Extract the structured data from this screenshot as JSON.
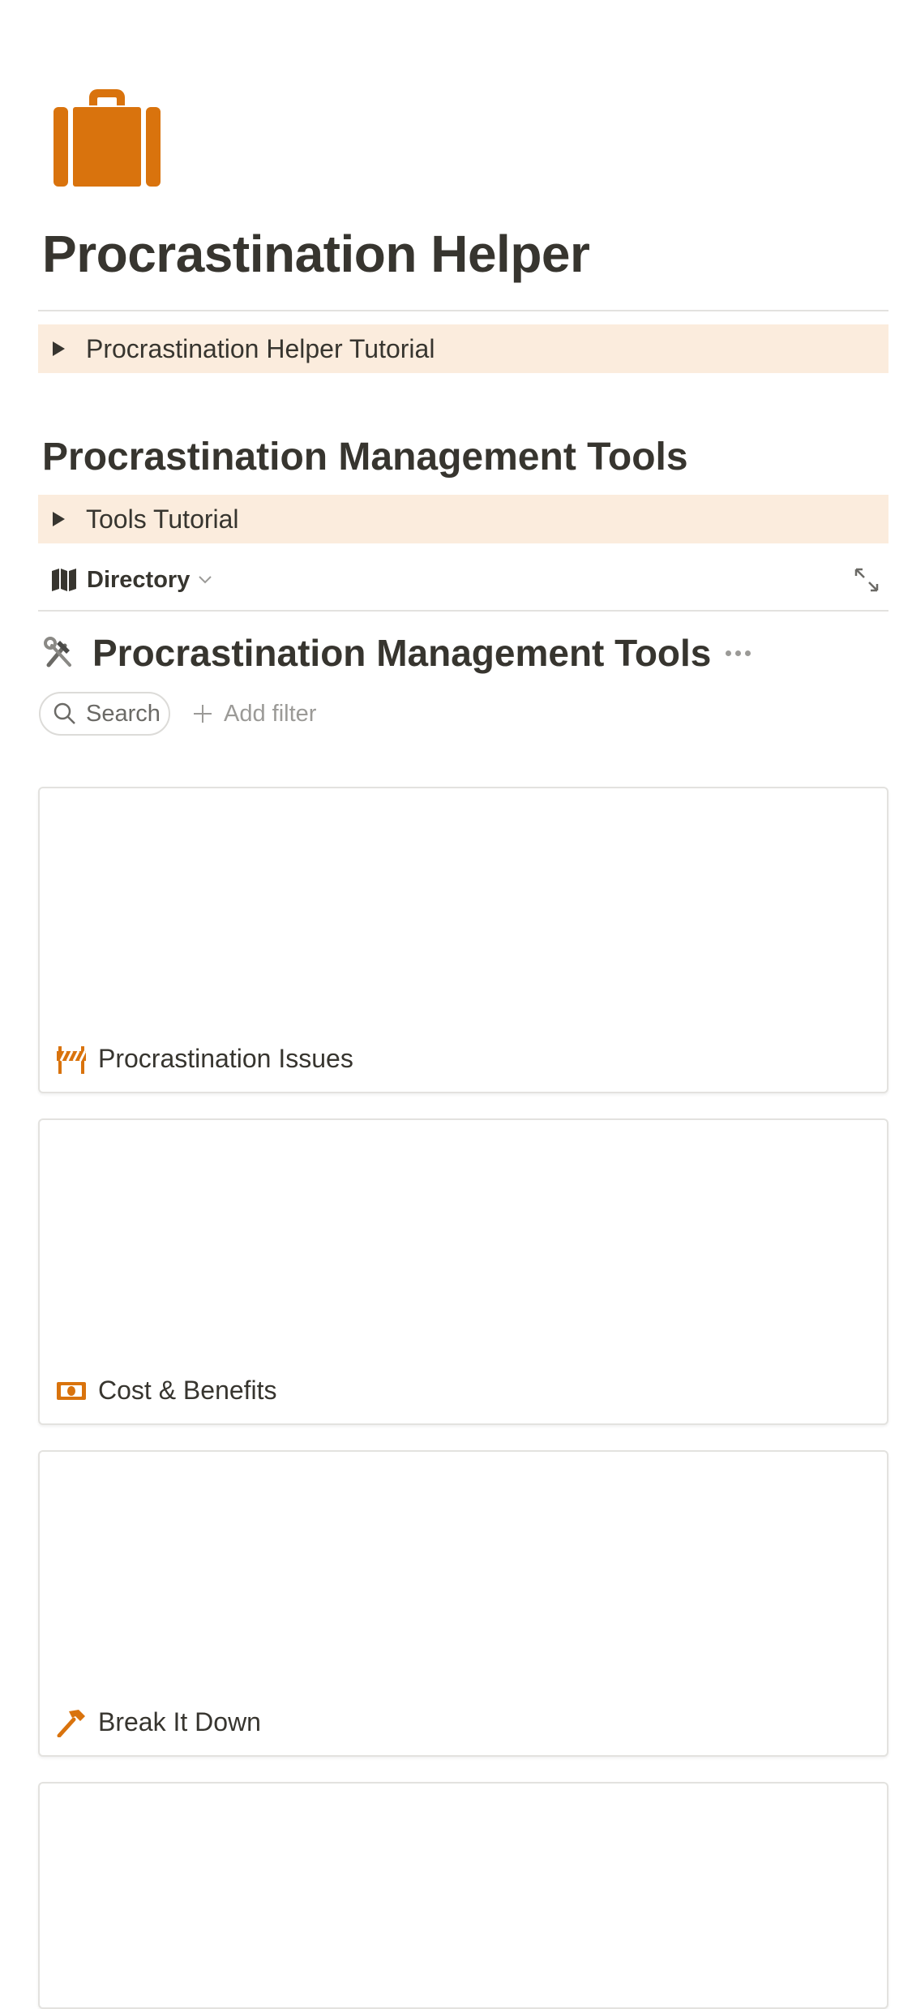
{
  "page": {
    "icon": "briefcase-icon",
    "icon_color": "#d9730d",
    "title": "Procrastination Helper"
  },
  "tutorial_toggle": {
    "label": "Procrastination Helper Tutorial",
    "background": "#fbecdd"
  },
  "section": {
    "heading": "Procrastination Management Tools",
    "tools_toggle_label": "Tools Tutorial"
  },
  "database": {
    "view_icon": "map-icon",
    "view_label": "Directory",
    "expand_icon": "expand-icon",
    "title_icon": "hammer-and-wrench-icon",
    "title": "Procrastination Management Tools",
    "search_placeholder": "Search",
    "add_filter_label": "Add filter",
    "cards": [
      {
        "icon": "construction-barrier-icon",
        "label": "Procrastination Issues"
      },
      {
        "icon": "banknote-icon",
        "label": "Cost & Benefits"
      },
      {
        "icon": "hammer-icon",
        "label": "Break It Down"
      },
      {
        "icon": "",
        "label": ""
      }
    ]
  },
  "colors": {
    "accent": "#d9730d",
    "text": "#37352f",
    "muted": "#9b9a97",
    "callout": "#fbecdd"
  }
}
